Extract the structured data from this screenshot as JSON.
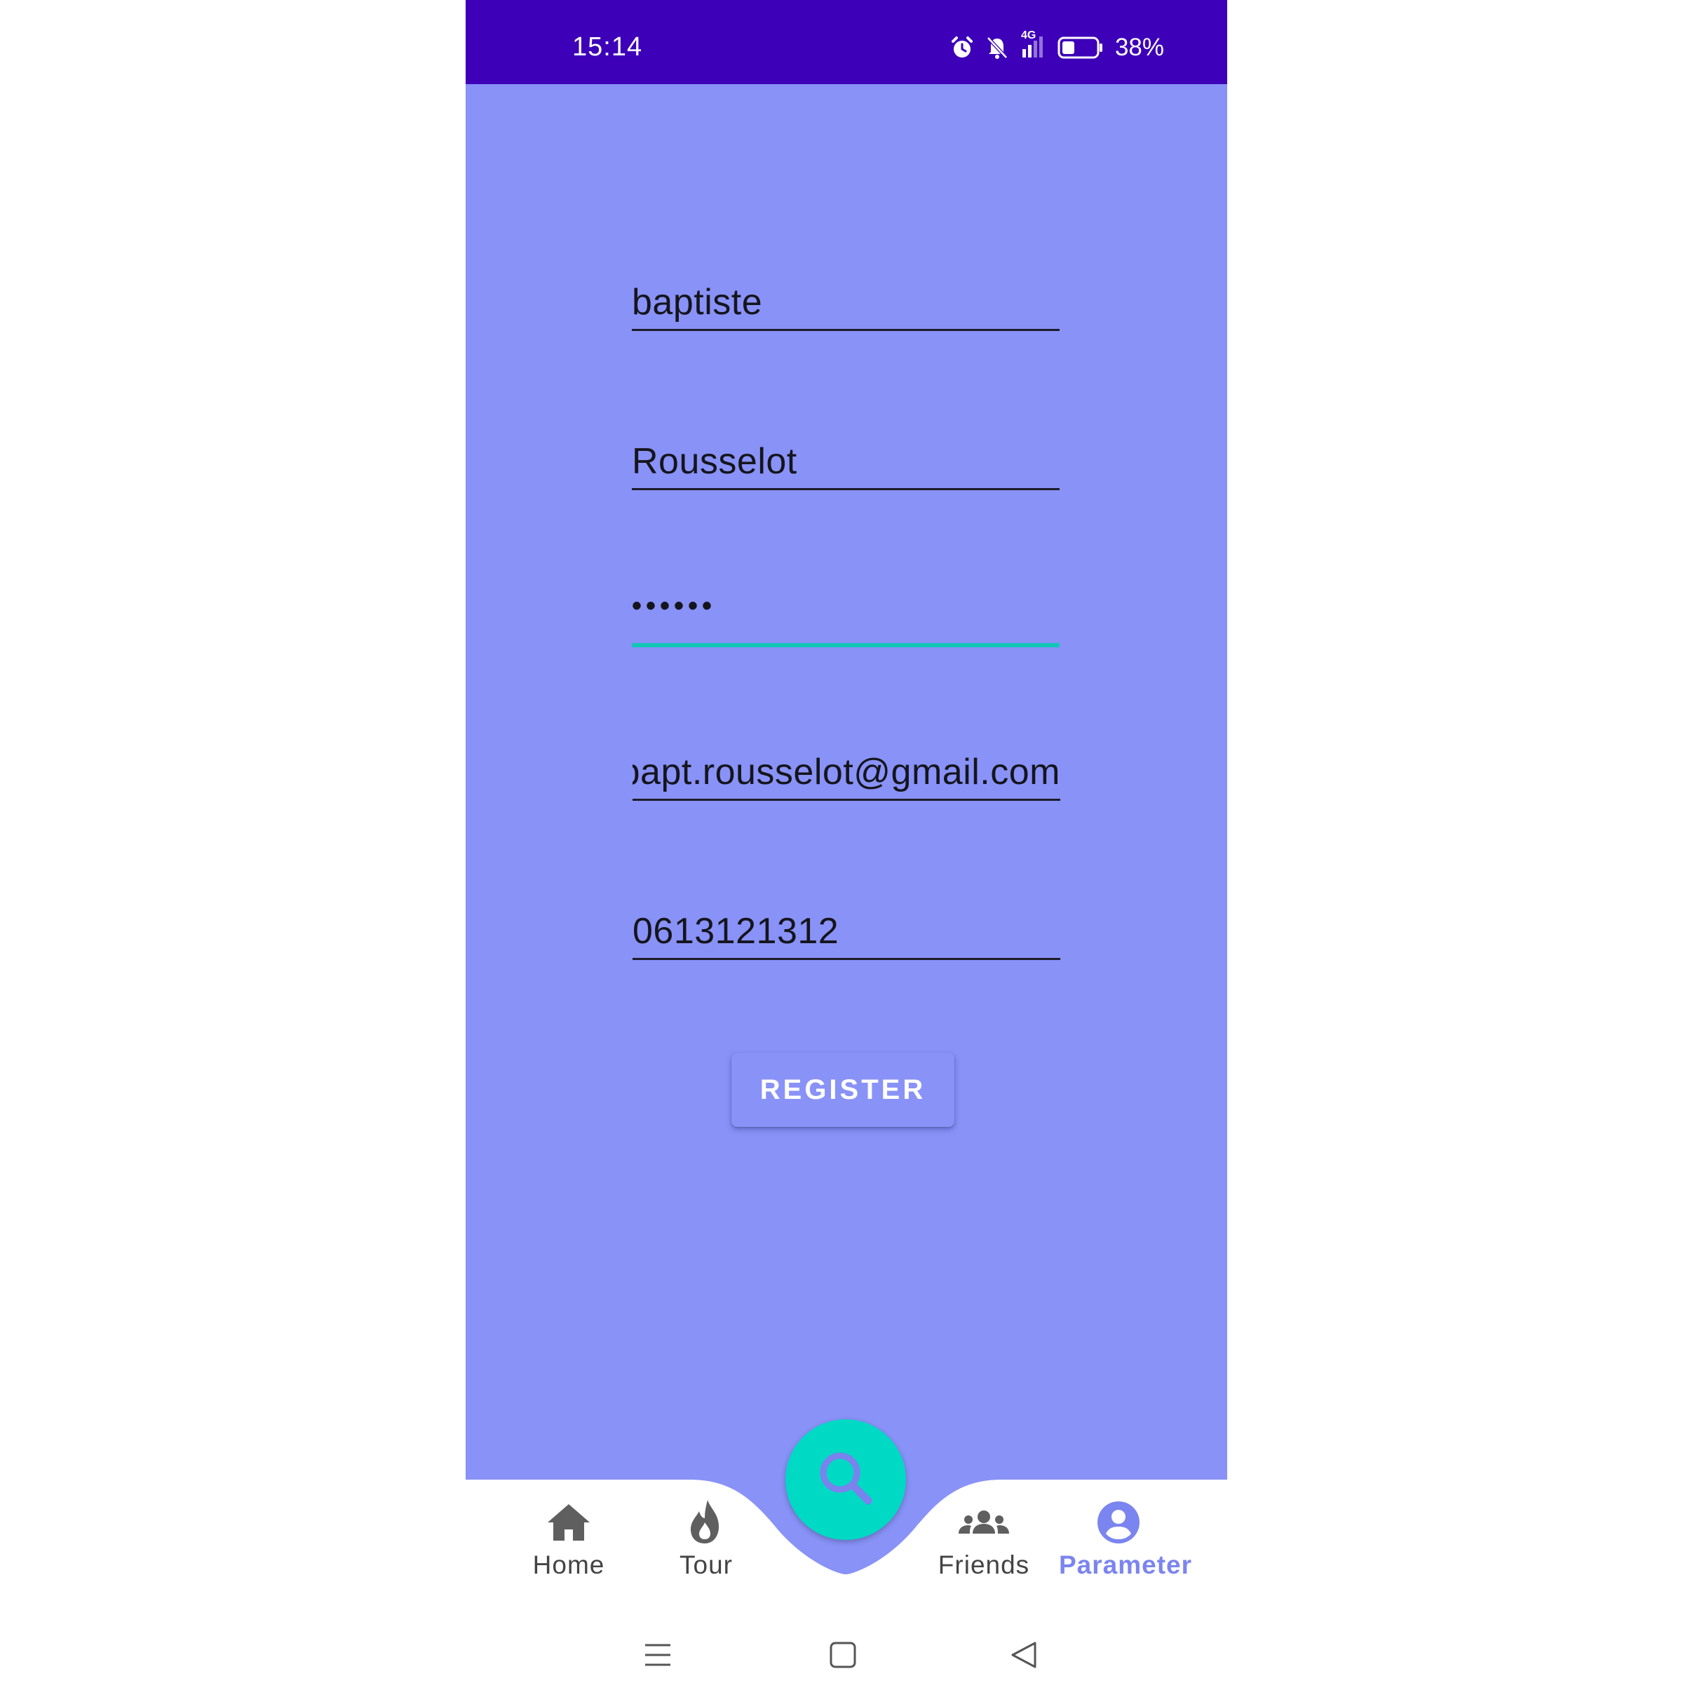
{
  "status_bar": {
    "time": "15:14",
    "network": "4G",
    "battery_percent": "38%",
    "battery_level": 0.38,
    "icons": [
      "alarm-icon",
      "bell-off-icon",
      "signal-icon",
      "battery-icon"
    ]
  },
  "form": {
    "first_name": "baptiste",
    "last_name": "Rousselot",
    "password_masked": "••••••",
    "email": "bapt.rousselot@gmail.com",
    "phone": "0613121312",
    "register_label": "REGISTER"
  },
  "bottom_nav": {
    "items": [
      {
        "label": "Home",
        "icon": "home-icon"
      },
      {
        "label": "Tour",
        "icon": "flame-icon"
      },
      {
        "label": "Friends",
        "icon": "group-icon"
      },
      {
        "label": "Parameter",
        "icon": "account-circle-icon",
        "active": true
      }
    ],
    "fab_icon": "search-icon"
  },
  "colors": {
    "status_bar": "#3d00b8",
    "background": "#8892f7",
    "accent": "#00d9c4",
    "active_nav": "#7b85ef"
  }
}
